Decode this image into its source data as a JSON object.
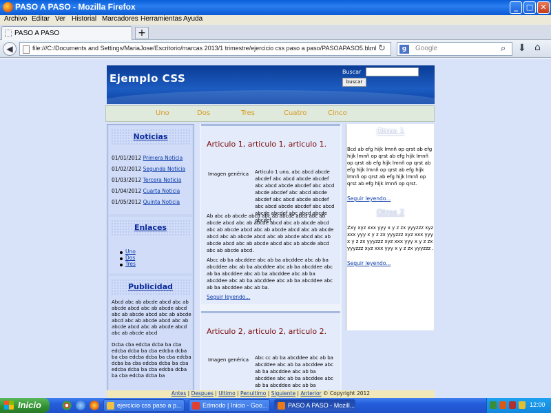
{
  "window": {
    "title": "PASO A PASO - Mozilla Firefox"
  },
  "menu": [
    "Archivo",
    "Editar",
    "Ver",
    "Historial",
    "Marcadores",
    "Herramientas",
    "Ayuda"
  ],
  "tab": {
    "title": "PASO A PASO",
    "new_tab": "+"
  },
  "nav": {
    "url": "file:///C:/Documents and Settings/MariaJose/Escritorio/marcas 2013/1 trimestre/ejercicio css paso a paso/PASOAPASO5.html",
    "search_engine": "Google",
    "search_placeholder": "Google"
  },
  "page": {
    "header": {
      "title": "Ejemplo CSS",
      "search_label": "Buscar",
      "search_button": "buscar"
    },
    "menu": [
      "Uno",
      "Dos",
      "Tres",
      "Cuatro",
      "Cinco"
    ],
    "noticias": {
      "title": "Noticias",
      "items": [
        {
          "date": "01/01/2012",
          "link": "Primera Noticia"
        },
        {
          "date": "01/02/2012",
          "link": "Segunda Noticia"
        },
        {
          "date": "01/03/2012",
          "link": "Tercera Noticia"
        },
        {
          "date": "01/04/2012",
          "link": "Cuarta Noticia"
        },
        {
          "date": "01/05/2012",
          "link": "Quinta Noticia"
        }
      ]
    },
    "enlaces": {
      "title": "Enlaces",
      "items": [
        "Uno",
        "Dos",
        "Tres"
      ]
    },
    "publicidad": {
      "title": "Publicidad",
      "text1": "Abcd abc ab abcde abcd abc ab abcde abcd abc ab abcde abcd abc ab abcde abcd abc ab abcde abcd abc ab abcde abcd abc ab abcde abcd abc ab abcde abcd abc ab abcde abcd",
      "text2": "Dcba cba edcba dcba ba cba edcba dcba ba cba edcba dcba ba cba edcba dcba ba cba edcba dcba ba cba edcba dcba ba cba edcba dcba ba cba edcba dcba ba cba edcba dcba ba"
    },
    "articles": [
      {
        "title": "Articulo 1, articulo 1, articulo 1.",
        "image_alt": "Imagen genérica",
        "p1": "Articulo 1 uno, abc abcd abcde abcdef abc abcd abcde abcdef abc abcd abcde abcdef abc abcd abcde abcdef abc abcd abcde abcdef abc abcd abcde abcdef abc abcd abcde abcdef abc abcd abcde abcdef abc abcd abcde abcdef.",
        "p2": "Ab abc ab abcde abcd abc ab abcde abcd abc ab abcde abcd abc ab abcde abcd abc ab abcde abcd abc ab abcde abcd abc ab abcde abcd abc ab abcde abcd abc ab abcde abcd abc ab abcde abcd abc ab abcde abcd abc ab abcde abcd abc ab abcde abcd abc ab abcde abcd.",
        "p3": "Abcc ab ba abcddee abc ab ba abcddee abc ab ba abcddee abc ab ba abcddee abc ab ba abcddee abc ab ba abcddee abc ab ba abcddee abc ab ba abcddee abc ab ba abcddee abc ab ba abcddee abc ab ba abcddee abc ab ba.",
        "more": "Seguir leyendo..."
      },
      {
        "title": "Articulo 2, articulo 2, articulo 2.",
        "image_alt": "Imagen genérica",
        "p1": "Abc cc ab ba abcddee abc ab ba abcddee abc ab ba abcddee abc ab ba abcddee abc ab ba abcddee abc ab ba abcddee abc ab ba abcddee abc ab ba abcddee abc ab ba abcddee abc ab ba abcddee abc ab ba"
      }
    ],
    "otros1": {
      "title": "Otros 1",
      "text": "Bcd ab efg hijk lmnñ op qrst ab efg hijk lmnñ op qrst ab efg hijk lmnñ op qrst ab efg hijk lmnñ op qrst ab efg hijk lmnñ op qrst ab efg hijk lmnñ op qrst ab efg hijk lmnñ op qrst ab efg hijk lmnñ op qrst.",
      "more": "Seguir leyendo..."
    },
    "otros2": {
      "title": "Otros 2",
      "text": "Zxy xyz xxx yyy x y z zx yyyzzz xyz xxx yyy x y z zx yyyzzz xyz xxx yyy x y z zx yyyzzz xyz xxx yyy x y z zx yyyzzz xyz xxx yyy x y z zx yyyzzz .",
      "more": "Seguir leyendo..."
    },
    "footer": {
      "links": [
        "Antes",
        "Despues",
        "Ultimo",
        "Penultimo",
        "Siguiente",
        "Anterior"
      ],
      "copyright": "© Copyright 2012"
    }
  },
  "taskbar": {
    "start": "Inicio",
    "buttons": [
      {
        "label": "ejercicio css paso a p...",
        "active": false,
        "icon_color": "#f0c040"
      },
      {
        "label": "Edmodo | Inicio - Goo...",
        "active": false,
        "icon_color": "#e04030"
      },
      {
        "label": "PASO A PASO - Mozill...",
        "active": true,
        "icon_color": "#e87a1a"
      }
    ],
    "clock": "12:00"
  }
}
